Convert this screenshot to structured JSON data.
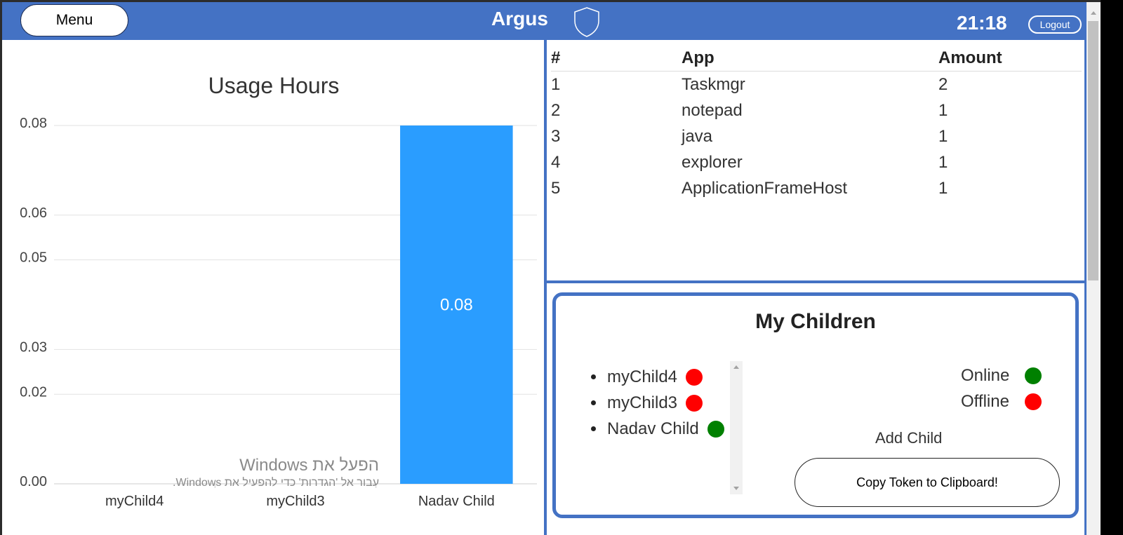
{
  "header": {
    "menu_label": "Menu",
    "title": "Argus",
    "time": "21:18",
    "logout_label": "Logout",
    "logo_icon": "shield-icon",
    "background": "#4472c4"
  },
  "chart_data": {
    "type": "bar",
    "title": "Usage Hours",
    "categories": [
      "myChild4",
      "myChild3",
      "Nadav Child"
    ],
    "values": [
      0,
      0,
      0.08
    ],
    "data_labels": [
      "",
      "",
      "0.08"
    ],
    "y_ticks": [
      "0.00",
      "0.02",
      "0.03",
      "0.05",
      "0.06",
      "0.08"
    ],
    "ylim": [
      0,
      0.08
    ],
    "bar_color": "#2a9dff",
    "grid": true
  },
  "app_table": {
    "headers": [
      "#",
      "App",
      "Amount"
    ],
    "rows": [
      [
        "1",
        "Taskmgr",
        "2"
      ],
      [
        "2",
        "notepad",
        "1"
      ],
      [
        "3",
        "java",
        "1"
      ],
      [
        "4",
        "explorer",
        "1"
      ],
      [
        "5",
        "ApplicationFrameHost",
        "1"
      ]
    ]
  },
  "children": {
    "title": "My Children",
    "items": [
      {
        "name": "myChild4",
        "status": "offline"
      },
      {
        "name": "myChild3",
        "status": "offline"
      },
      {
        "name": "Nadav Child",
        "status": "online"
      }
    ],
    "legend_online": "Online",
    "legend_offline": "Offline",
    "online_color": "#008000",
    "offline_color": "#ff0000",
    "add_child_label": "Add Child",
    "copy_token_label": "Copy Token to Clipboard!"
  },
  "watermark": {
    "line1": "הפעל את Windows",
    "line2": "עבור אל 'הגדרות' כדי להפעיל את Windows."
  }
}
